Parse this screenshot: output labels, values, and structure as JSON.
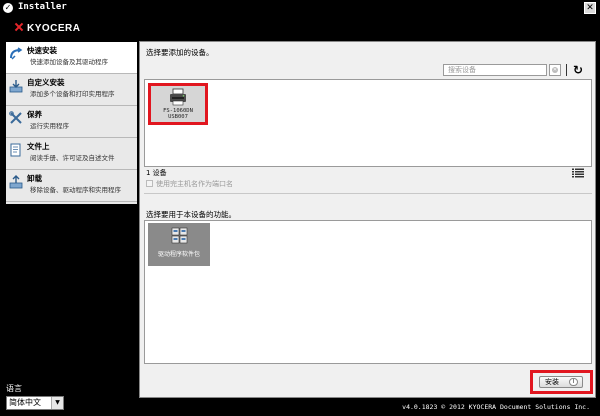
{
  "window": {
    "title": "Installer"
  },
  "brand": {
    "name": "KYOCERA"
  },
  "sidebar": {
    "items": [
      {
        "title": "快速安装",
        "desc": "快速添加设备及其驱动程序",
        "icon": "quick-install-icon"
      },
      {
        "title": "自定义安装",
        "desc": "添加多个设备和打印实用程序",
        "icon": "custom-install-icon"
      },
      {
        "title": "保养",
        "desc": "运行实用程序",
        "icon": "tools-icon"
      },
      {
        "title": "文件上",
        "desc": "阅读手册、许可证及自述文件",
        "icon": "document-icon"
      },
      {
        "title": "卸载",
        "desc": "移除设备、驱动程序和实用程序",
        "icon": "uninstall-icon"
      }
    ]
  },
  "language": {
    "label": "语言",
    "selected": "简体中文"
  },
  "main": {
    "device_heading": "选择要添加的设备。",
    "search_placeholder": "搜索设备",
    "devices": [
      {
        "model": "FS-1060DN",
        "connection": "USB007"
      }
    ],
    "device_count": "1 设备",
    "checkbox_label": "使用完主机名作为端口名",
    "function_heading": "选择要用于本设备的功能。",
    "functions": [
      {
        "label": "驱动程序软件包"
      }
    ],
    "install_label": "安装",
    "install_key": "I"
  },
  "version": "v4.0.1823 © 2012 KYOCERA Document Solutions Inc.",
  "colors": {
    "highlight": "#e1161f",
    "brand_accent": "#e4262b",
    "background": "#000000"
  }
}
